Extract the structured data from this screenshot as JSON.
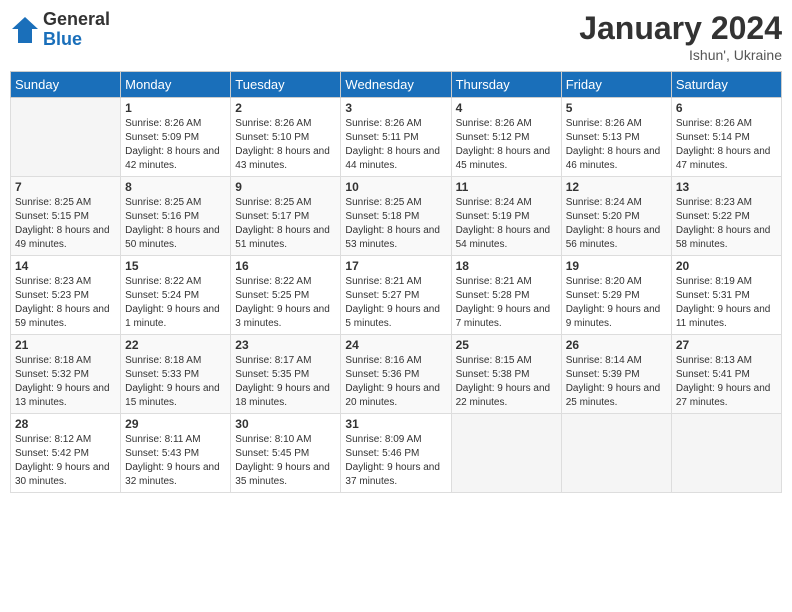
{
  "logo": {
    "general": "General",
    "blue": "Blue"
  },
  "title": "January 2024",
  "location": "Ishun', Ukraine",
  "days_header": [
    "Sunday",
    "Monday",
    "Tuesday",
    "Wednesday",
    "Thursday",
    "Friday",
    "Saturday"
  ],
  "weeks": [
    [
      {
        "num": "",
        "sunrise": "",
        "sunset": "",
        "daylight": ""
      },
      {
        "num": "1",
        "sunrise": "Sunrise: 8:26 AM",
        "sunset": "Sunset: 5:09 PM",
        "daylight": "Daylight: 8 hours and 42 minutes."
      },
      {
        "num": "2",
        "sunrise": "Sunrise: 8:26 AM",
        "sunset": "Sunset: 5:10 PM",
        "daylight": "Daylight: 8 hours and 43 minutes."
      },
      {
        "num": "3",
        "sunrise": "Sunrise: 8:26 AM",
        "sunset": "Sunset: 5:11 PM",
        "daylight": "Daylight: 8 hours and 44 minutes."
      },
      {
        "num": "4",
        "sunrise": "Sunrise: 8:26 AM",
        "sunset": "Sunset: 5:12 PM",
        "daylight": "Daylight: 8 hours and 45 minutes."
      },
      {
        "num": "5",
        "sunrise": "Sunrise: 8:26 AM",
        "sunset": "Sunset: 5:13 PM",
        "daylight": "Daylight: 8 hours and 46 minutes."
      },
      {
        "num": "6",
        "sunrise": "Sunrise: 8:26 AM",
        "sunset": "Sunset: 5:14 PM",
        "daylight": "Daylight: 8 hours and 47 minutes."
      }
    ],
    [
      {
        "num": "7",
        "sunrise": "Sunrise: 8:25 AM",
        "sunset": "Sunset: 5:15 PM",
        "daylight": "Daylight: 8 hours and 49 minutes."
      },
      {
        "num": "8",
        "sunrise": "Sunrise: 8:25 AM",
        "sunset": "Sunset: 5:16 PM",
        "daylight": "Daylight: 8 hours and 50 minutes."
      },
      {
        "num": "9",
        "sunrise": "Sunrise: 8:25 AM",
        "sunset": "Sunset: 5:17 PM",
        "daylight": "Daylight: 8 hours and 51 minutes."
      },
      {
        "num": "10",
        "sunrise": "Sunrise: 8:25 AM",
        "sunset": "Sunset: 5:18 PM",
        "daylight": "Daylight: 8 hours and 53 minutes."
      },
      {
        "num": "11",
        "sunrise": "Sunrise: 8:24 AM",
        "sunset": "Sunset: 5:19 PM",
        "daylight": "Daylight: 8 hours and 54 minutes."
      },
      {
        "num": "12",
        "sunrise": "Sunrise: 8:24 AM",
        "sunset": "Sunset: 5:20 PM",
        "daylight": "Daylight: 8 hours and 56 minutes."
      },
      {
        "num": "13",
        "sunrise": "Sunrise: 8:23 AM",
        "sunset": "Sunset: 5:22 PM",
        "daylight": "Daylight: 8 hours and 58 minutes."
      }
    ],
    [
      {
        "num": "14",
        "sunrise": "Sunrise: 8:23 AM",
        "sunset": "Sunset: 5:23 PM",
        "daylight": "Daylight: 8 hours and 59 minutes."
      },
      {
        "num": "15",
        "sunrise": "Sunrise: 8:22 AM",
        "sunset": "Sunset: 5:24 PM",
        "daylight": "Daylight: 9 hours and 1 minute."
      },
      {
        "num": "16",
        "sunrise": "Sunrise: 8:22 AM",
        "sunset": "Sunset: 5:25 PM",
        "daylight": "Daylight: 9 hours and 3 minutes."
      },
      {
        "num": "17",
        "sunrise": "Sunrise: 8:21 AM",
        "sunset": "Sunset: 5:27 PM",
        "daylight": "Daylight: 9 hours and 5 minutes."
      },
      {
        "num": "18",
        "sunrise": "Sunrise: 8:21 AM",
        "sunset": "Sunset: 5:28 PM",
        "daylight": "Daylight: 9 hours and 7 minutes."
      },
      {
        "num": "19",
        "sunrise": "Sunrise: 8:20 AM",
        "sunset": "Sunset: 5:29 PM",
        "daylight": "Daylight: 9 hours and 9 minutes."
      },
      {
        "num": "20",
        "sunrise": "Sunrise: 8:19 AM",
        "sunset": "Sunset: 5:31 PM",
        "daylight": "Daylight: 9 hours and 11 minutes."
      }
    ],
    [
      {
        "num": "21",
        "sunrise": "Sunrise: 8:18 AM",
        "sunset": "Sunset: 5:32 PM",
        "daylight": "Daylight: 9 hours and 13 minutes."
      },
      {
        "num": "22",
        "sunrise": "Sunrise: 8:18 AM",
        "sunset": "Sunset: 5:33 PM",
        "daylight": "Daylight: 9 hours and 15 minutes."
      },
      {
        "num": "23",
        "sunrise": "Sunrise: 8:17 AM",
        "sunset": "Sunset: 5:35 PM",
        "daylight": "Daylight: 9 hours and 18 minutes."
      },
      {
        "num": "24",
        "sunrise": "Sunrise: 8:16 AM",
        "sunset": "Sunset: 5:36 PM",
        "daylight": "Daylight: 9 hours and 20 minutes."
      },
      {
        "num": "25",
        "sunrise": "Sunrise: 8:15 AM",
        "sunset": "Sunset: 5:38 PM",
        "daylight": "Daylight: 9 hours and 22 minutes."
      },
      {
        "num": "26",
        "sunrise": "Sunrise: 8:14 AM",
        "sunset": "Sunset: 5:39 PM",
        "daylight": "Daylight: 9 hours and 25 minutes."
      },
      {
        "num": "27",
        "sunrise": "Sunrise: 8:13 AM",
        "sunset": "Sunset: 5:41 PM",
        "daylight": "Daylight: 9 hours and 27 minutes."
      }
    ],
    [
      {
        "num": "28",
        "sunrise": "Sunrise: 8:12 AM",
        "sunset": "Sunset: 5:42 PM",
        "daylight": "Daylight: 9 hours and 30 minutes."
      },
      {
        "num": "29",
        "sunrise": "Sunrise: 8:11 AM",
        "sunset": "Sunset: 5:43 PM",
        "daylight": "Daylight: 9 hours and 32 minutes."
      },
      {
        "num": "30",
        "sunrise": "Sunrise: 8:10 AM",
        "sunset": "Sunset: 5:45 PM",
        "daylight": "Daylight: 9 hours and 35 minutes."
      },
      {
        "num": "31",
        "sunrise": "Sunrise: 8:09 AM",
        "sunset": "Sunset: 5:46 PM",
        "daylight": "Daylight: 9 hours and 37 minutes."
      },
      {
        "num": "",
        "sunrise": "",
        "sunset": "",
        "daylight": ""
      },
      {
        "num": "",
        "sunrise": "",
        "sunset": "",
        "daylight": ""
      },
      {
        "num": "",
        "sunrise": "",
        "sunset": "",
        "daylight": ""
      }
    ]
  ]
}
